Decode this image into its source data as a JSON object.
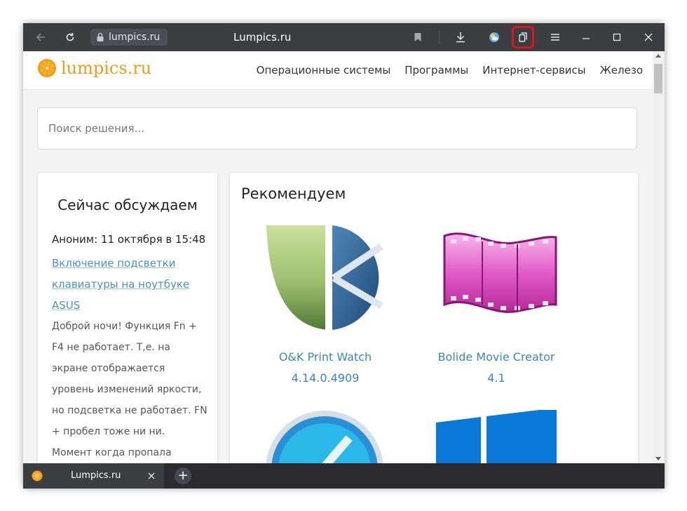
{
  "browser": {
    "address": "lumpics.ru",
    "title": "Lumpics.ru",
    "icons": [
      "back-arrow-icon",
      "refresh-icon",
      "lock-icon",
      "bookmark-icon",
      "download-icon",
      "weather-icon",
      "collections-icon",
      "menu-icon",
      "minimize-icon",
      "maximize-icon",
      "close-icon"
    ],
    "highlight_color": "#e0141c"
  },
  "site": {
    "logo": "lumpics.ru",
    "brand_color": "#f19a1a",
    "nav": [
      "Операционные системы",
      "Программы",
      "Интернет-сервисы",
      "Железо"
    ]
  },
  "search": {
    "placeholder": "Поиск решения..."
  },
  "discussion": {
    "title": "Сейчас обсуждаем",
    "author": "Аноним: 11 октября в 15:48",
    "link": "Включение подсветки клавиатуры на ноутбуке ASUS",
    "text": "Доброй ночи! Функция Fn + F4 не работает. Т,е. на экране отображается уровень изменений яркости, но подсветка не работает. FN + пробел тоже ни ни. Момент когда пропала подсветка я не"
  },
  "recommend": {
    "title": "Рекомендуем",
    "apps": [
      {
        "name": "O&K Print Watch",
        "version": "4.14.0.4909"
      },
      {
        "name": "Bolide Movie Creator",
        "version": "4.1"
      }
    ]
  },
  "tabbar": {
    "tab_title": "Lumpics.ru",
    "new_tab": "+"
  }
}
